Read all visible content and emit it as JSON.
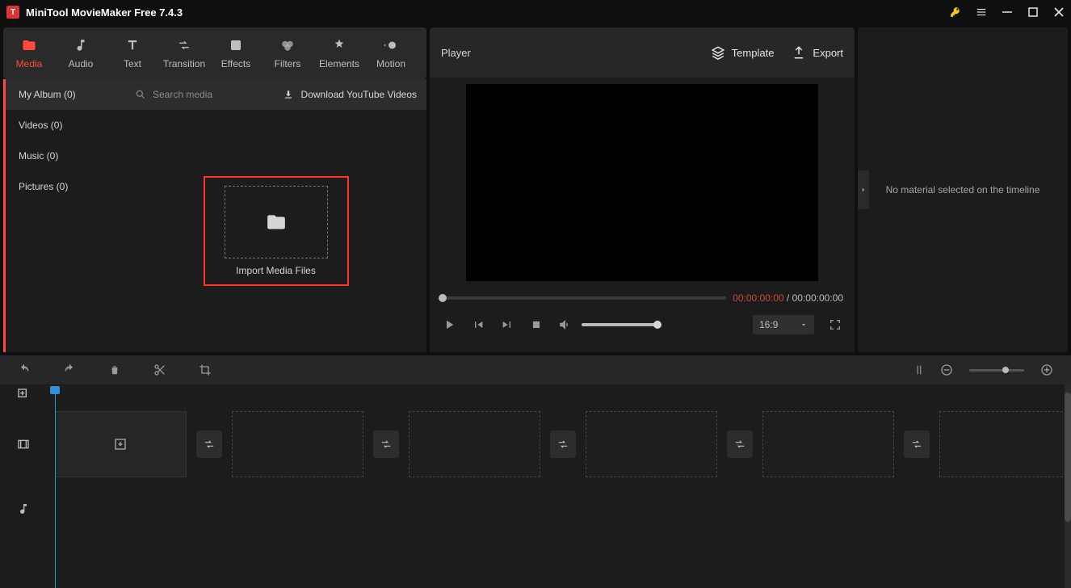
{
  "app": {
    "title": "MiniTool MovieMaker Free 7.4.3"
  },
  "toolbar": {
    "tabs": [
      {
        "label": "Media"
      },
      {
        "label": "Audio"
      },
      {
        "label": "Text"
      },
      {
        "label": "Transition"
      },
      {
        "label": "Effects"
      },
      {
        "label": "Filters"
      },
      {
        "label": "Elements"
      },
      {
        "label": "Motion"
      }
    ]
  },
  "library": {
    "sidebar": [
      {
        "label": "My Album (0)"
      },
      {
        "label": "Videos (0)"
      },
      {
        "label": "Music (0)"
      },
      {
        "label": "Pictures (0)"
      }
    ],
    "search_placeholder": "Search media",
    "download_label": "Download YouTube Videos",
    "import_label": "Import Media Files"
  },
  "player": {
    "title": "Player",
    "template_label": "Template",
    "export_label": "Export",
    "time_current": "00:00:00:00",
    "time_sep": " / ",
    "time_total": "00:00:00:00",
    "aspect": "16:9"
  },
  "inspector": {
    "message": "No material selected on the timeline"
  }
}
